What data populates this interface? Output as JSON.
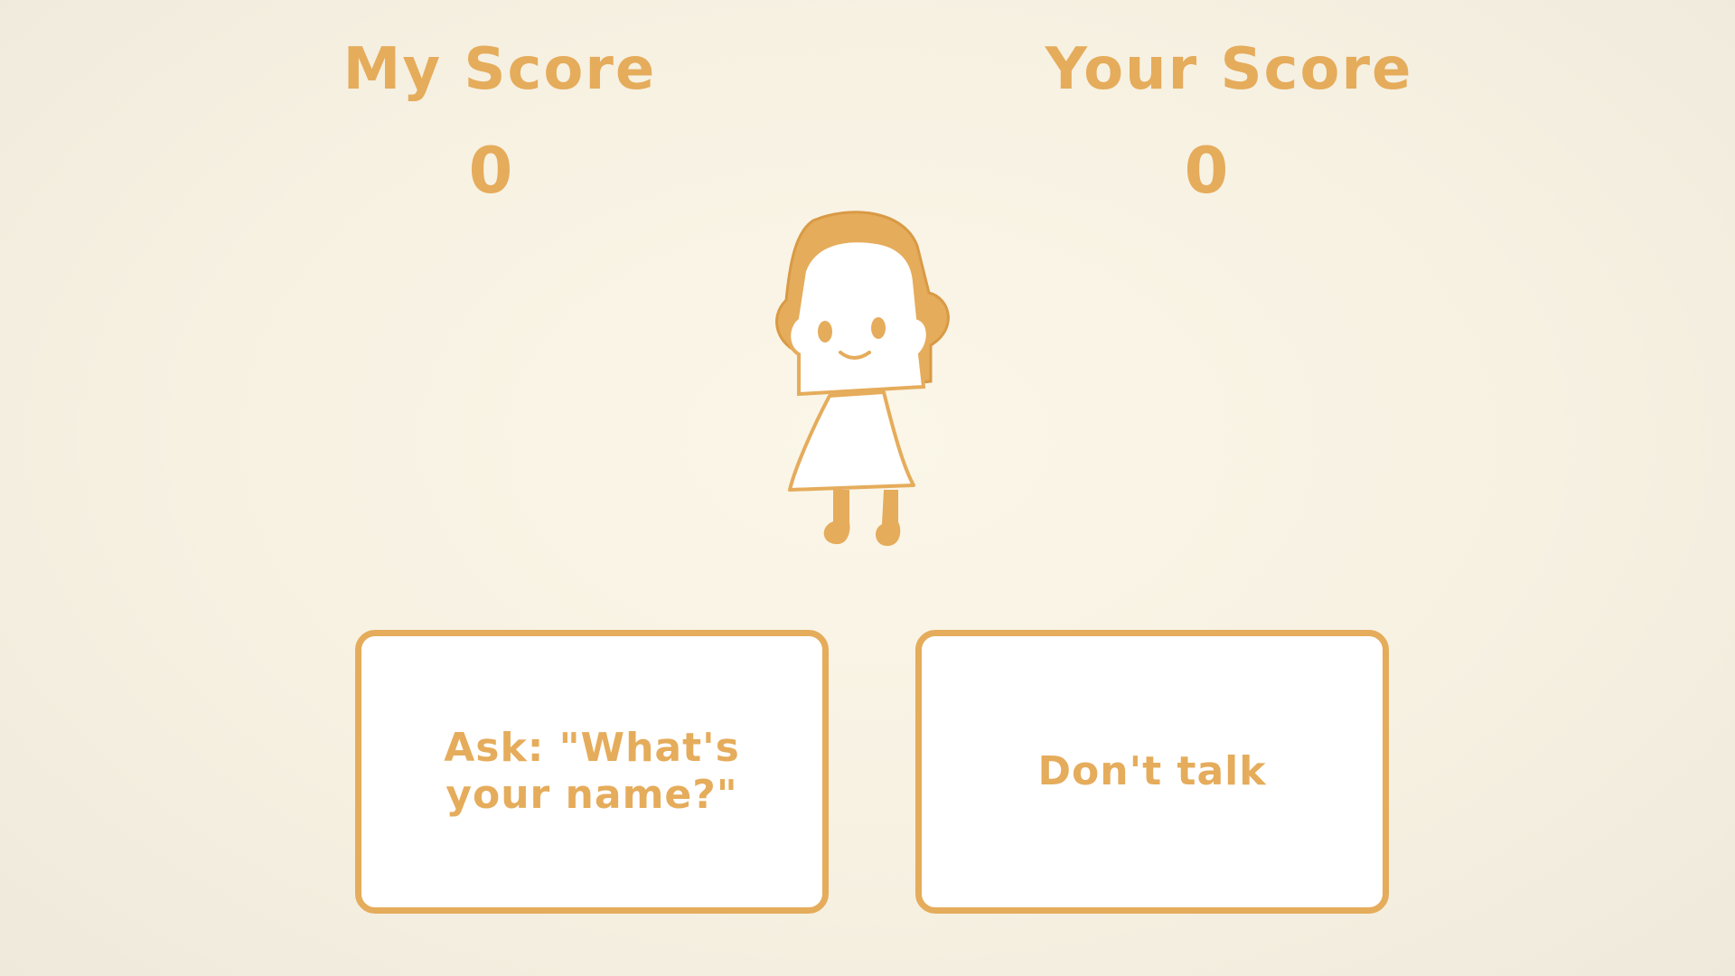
{
  "scores": {
    "mine": {
      "label": "My Score",
      "value": "0"
    },
    "yours": {
      "label": "Your Score",
      "value": "0"
    }
  },
  "character": {
    "icon": "girl-character-icon"
  },
  "choices": [
    {
      "text": "Ask: \"What's your name?\""
    },
    {
      "text": "Don't talk"
    }
  ],
  "colors": {
    "accent": "#e5ac5b",
    "background": "#f7f1e2",
    "card": "#ffffff"
  }
}
